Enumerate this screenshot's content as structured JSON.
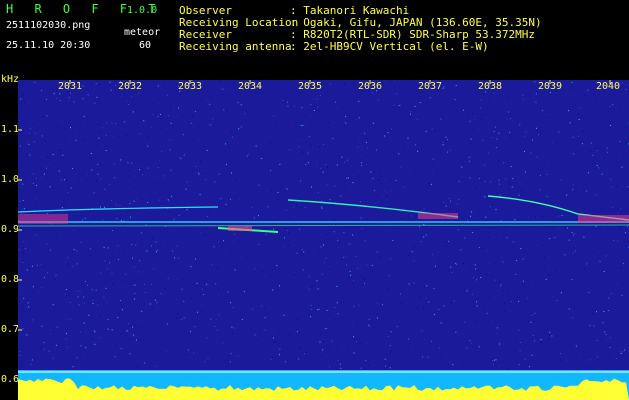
{
  "app": {
    "title": "H R O F F T",
    "version": "1.0.0"
  },
  "file": {
    "name": "2511102030.png",
    "datetime": "25.11.10 20:30"
  },
  "meteor": {
    "label": "meteor",
    "count": "60"
  },
  "info": {
    "observer": {
      "label": "Observer",
      "value": ": Takanori Kawachi"
    },
    "location": {
      "label": "Receiving Location",
      "value": ": Ogaki, Gifu, JAPAN (136.60E, 35.35N)"
    },
    "receiver": {
      "label": "Receiver",
      "value": ": R820T2(RTL-SDR) SDR-Sharp 53.372MHz"
    },
    "antenna": {
      "label": "Receiving antenna",
      "value": ": 2el-HB9CV Vertical (el. E-W)"
    }
  },
  "colors": {
    "label_green": "#3cff3c",
    "axis_yellow": "#ffff4a",
    "background_blue": "#1a1a9a"
  },
  "spectrogram": {
    "y_unit": "kHz",
    "y_ticks": [
      "1.1",
      "1.0",
      "0.9",
      "0.8",
      "0.7",
      "0.6"
    ],
    "x_ticks": [
      "2031",
      "2032",
      "2033",
      "2034",
      "2035",
      "2036",
      "2037",
      "2038",
      "2039",
      "2040"
    ]
  }
}
